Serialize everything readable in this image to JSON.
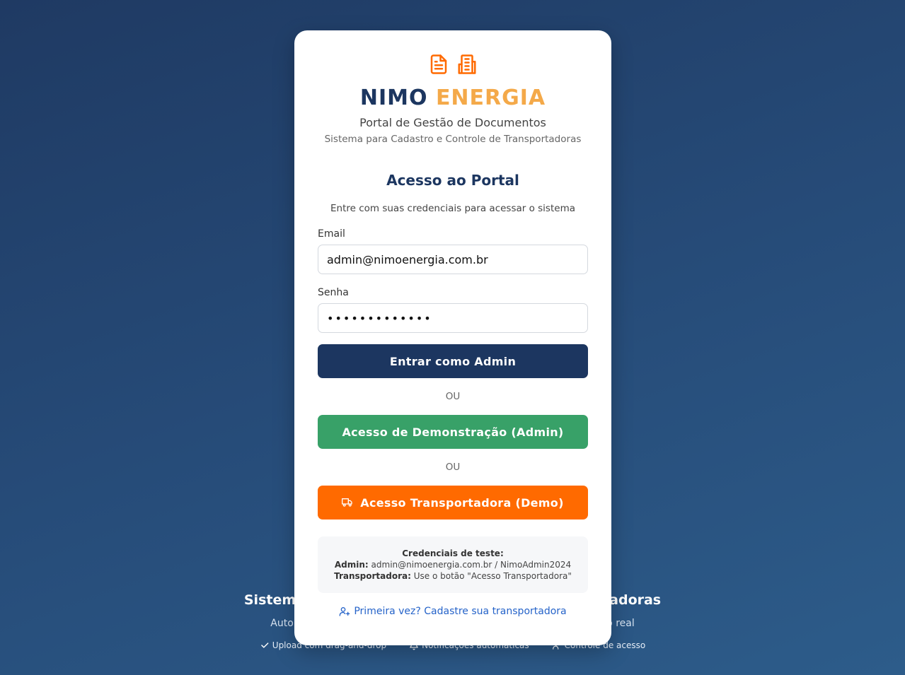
{
  "background": {
    "title": "Sistema de Gestão de Documentos de Transportadoras",
    "subtitle": "Automatize o processo de cadastro e acompanhe o status em tempo real",
    "features": [
      {
        "icon": "check-icon",
        "label": "Upload com drag-and-drop"
      },
      {
        "icon": "bell-icon",
        "label": "Notificações automáticas"
      },
      {
        "icon": "users-icon",
        "label": "Controle de acesso"
      }
    ]
  },
  "card": {
    "icons": [
      "document-icon",
      "building-icon"
    ],
    "brand_primary": "NIMO",
    "brand_accent": "ENERGIA",
    "portal_title": "Portal de Gestão de Documentos",
    "portal_subtitle": "Sistema para Cadastro e Controle de Transportadoras",
    "access_title": "Acesso ao Portal",
    "access_desc": "Entre com suas credenciais para acessar o sistema",
    "email_label": "Email",
    "email_value": "admin@nimoenergia.com.br",
    "password_label": "Senha",
    "password_value": "NimoAdmin2024",
    "login_button": "Entrar como Admin",
    "or_1": "OU",
    "demo_button": "Acesso de Demonstração (Admin)",
    "or_2": "OU",
    "carrier_button": "Acesso Transportadora (Demo)",
    "credentials": {
      "title": "Credenciais de teste:",
      "admin_label": "Admin:",
      "admin_value": "admin@nimoenergia.com.br / NimoAdmin2024",
      "carrier_label": "Transportadora:",
      "carrier_value": "Use o botão \"Acesso Transportadora\""
    },
    "register_link": "Primeira vez? Cadastre sua transportadora"
  },
  "colors": {
    "navy": "#1c3660",
    "accent_orange_text": "#f4a949",
    "green": "#38a168",
    "orange": "#ff6a00",
    "link_blue": "#2563c9"
  }
}
